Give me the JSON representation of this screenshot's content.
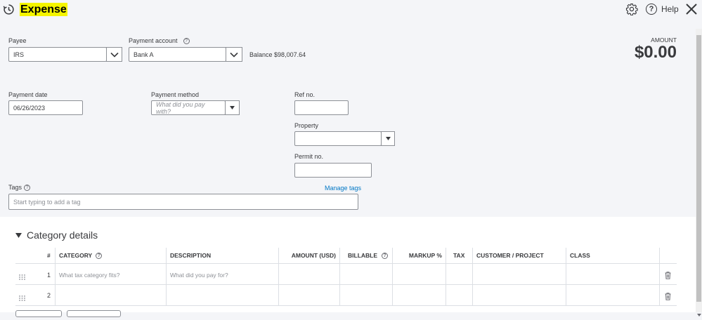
{
  "header": {
    "title": "Expense",
    "help_label": "Help"
  },
  "form": {
    "payee_label": "Payee",
    "payee_value": "IRS",
    "payment_account_label": "Payment account",
    "payment_account_value": "Bank A",
    "balance_label": "Balance",
    "balance_value": "$98,007.64",
    "amount_label": "AMOUNT",
    "amount_value": "$0.00",
    "payment_date_label": "Payment date",
    "payment_date_value": "06/26/2023",
    "payment_method_label": "Payment method",
    "payment_method_placeholder": "What did you pay with?",
    "ref_no_label": "Ref no.",
    "property_label": "Property",
    "permit_no_label": "Permit no.",
    "tags_label": "Tags",
    "manage_tags_label": "Manage tags",
    "tags_placeholder": "Start typing to add a tag"
  },
  "category_details": {
    "title": "Category details",
    "columns": {
      "num": "#",
      "category": "CATEGORY",
      "description": "DESCRIPTION",
      "amount": "AMOUNT (USD)",
      "billable": "BILLABLE",
      "markup": "MARKUP %",
      "tax": "TAX",
      "customer": "CUSTOMER / PROJECT",
      "class": "CLASS"
    },
    "rows": [
      {
        "num": "1",
        "category_placeholder": "What tax category fits?",
        "description_placeholder": "What did you pay for?"
      },
      {
        "num": "2",
        "category_placeholder": "",
        "description_placeholder": ""
      }
    ]
  },
  "colors": {
    "accent_highlight": "#f5f500",
    "link": "#0077c5",
    "background": "#f4f5f8"
  }
}
